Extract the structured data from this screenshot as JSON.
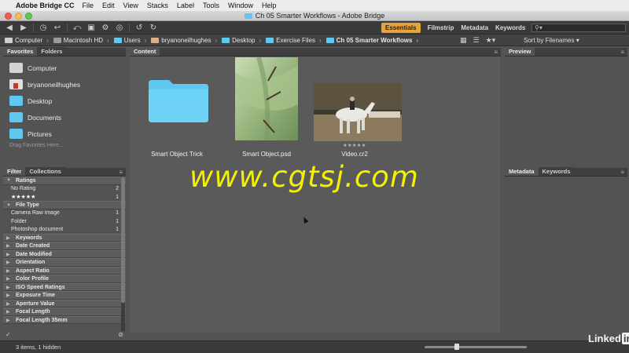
{
  "menubar": {
    "app_name": "Adobe Bridge CC",
    "items": [
      "File",
      "Edit",
      "View",
      "Stacks",
      "Label",
      "Tools",
      "Window",
      "Help"
    ]
  },
  "window": {
    "title": "Ch 05 Smarter Workflows - Adobe Bridge"
  },
  "toolbar": {
    "workspaces": [
      "Essentials",
      "Filmstrip",
      "Metadata",
      "Keywords"
    ],
    "active_workspace": "Essentials",
    "search_placeholder": "⚲▾"
  },
  "path": {
    "crumbs": [
      {
        "label": "Computer",
        "icon": "computer-icon"
      },
      {
        "label": "Macintosh HD",
        "icon": "disk-icon"
      },
      {
        "label": "Users",
        "icon": "folder-icon"
      },
      {
        "label": "bryanoneilhughes",
        "icon": "user-icon"
      },
      {
        "label": "Desktop",
        "icon": "folder-icon"
      },
      {
        "label": "Exercise Files",
        "icon": "folder-icon"
      },
      {
        "label": "Ch 05 Smarter Workflows",
        "icon": "folder-icon"
      }
    ],
    "sort_label": "Sort by Filenames ▾"
  },
  "favorites": {
    "tabs": [
      "Favorites",
      "Folders"
    ],
    "items": [
      {
        "label": "Computer",
        "icon": "computer-icon"
      },
      {
        "label": "bryanoneilhughes",
        "icon": "home-icon"
      },
      {
        "label": "Desktop",
        "icon": "folder-icon"
      },
      {
        "label": "Documents",
        "icon": "folder-icon"
      },
      {
        "label": "Pictures",
        "icon": "folder-icon"
      }
    ],
    "hint": "Drag Favorites Here..."
  },
  "filter": {
    "tabs": [
      "Filter",
      "Collections"
    ],
    "ratings_head": "Ratings",
    "ratings": [
      {
        "label": "No Rating",
        "count": "2"
      },
      {
        "label": "★★★★★",
        "count": "1"
      }
    ],
    "filetype_head": "File Type",
    "filetypes": [
      {
        "label": "Camera Raw image",
        "count": "1"
      },
      {
        "label": "Folder",
        "count": "1"
      },
      {
        "label": "Photoshop document",
        "count": "1"
      }
    ],
    "sections": [
      "Keywords",
      "Date Created",
      "Date Modified",
      "Orientation",
      "Aspect Ratio",
      "Color Profile",
      "ISO Speed Ratings",
      "Exposure Time",
      "Aperture Value",
      "Focal Length",
      "Focal Length 35mm"
    ]
  },
  "content": {
    "tab": "Content",
    "items": [
      {
        "label": "Smart Object Trick",
        "type": "folder",
        "rating": ""
      },
      {
        "label": "Smart Object.psd",
        "type": "psd",
        "rating": ""
      },
      {
        "label": "Video.cr2",
        "type": "raw",
        "rating": "★★★★★"
      }
    ]
  },
  "preview": {
    "tab": "Preview"
  },
  "metadata": {
    "tabs": [
      "Metadata",
      "Keywords"
    ]
  },
  "status": {
    "count": "3 items, 1 hidden"
  },
  "watermark": "www.cgtsj.com",
  "linkedin": {
    "word": "Linked",
    "in": "in"
  },
  "colors": {
    "accent": "#e8a238",
    "folder": "#5fc8f0",
    "watermark": "#f4f000"
  }
}
